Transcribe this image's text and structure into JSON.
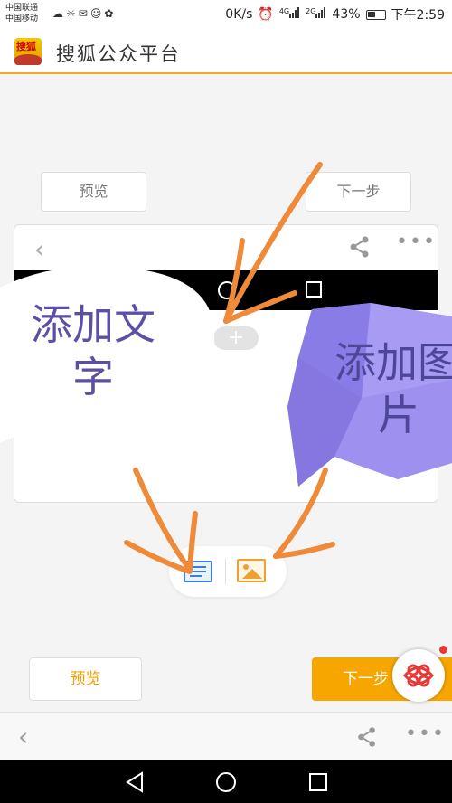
{
  "status_bar": {
    "carrier_1": "中国联通",
    "carrier_2": "中国移动",
    "net_speed": "0K/s",
    "net_4g": "4G",
    "net_2g": "2G",
    "battery": "43%",
    "time": "下午2:59"
  },
  "app": {
    "title": "搜狐公众平台",
    "logo_text": "搜狐"
  },
  "top_actions": {
    "preview_label": "预览",
    "next_label": "下一步"
  },
  "bottom_actions": {
    "preview_label": "预览",
    "next_label": "下一步"
  },
  "editor": {
    "add_label": "+"
  },
  "annotations": {
    "add_text_line1": "添加文",
    "add_text_line2": "字",
    "add_image_line1": "添加图",
    "add_image_line2": "片"
  },
  "colors": {
    "accent": "#f7a600",
    "arrow": "#ee8a3a",
    "bubble_purple": "#9b8cf0",
    "annotation_text": "#5b4fa6"
  },
  "icons": [
    "wechat-icon",
    "alarm-icon",
    "signal-icon",
    "battery-icon",
    "back-icon",
    "share-icon",
    "more-icon",
    "text-block-icon",
    "image-icon",
    "unicom-logo-icon",
    "home-icon",
    "recent-icon"
  ]
}
